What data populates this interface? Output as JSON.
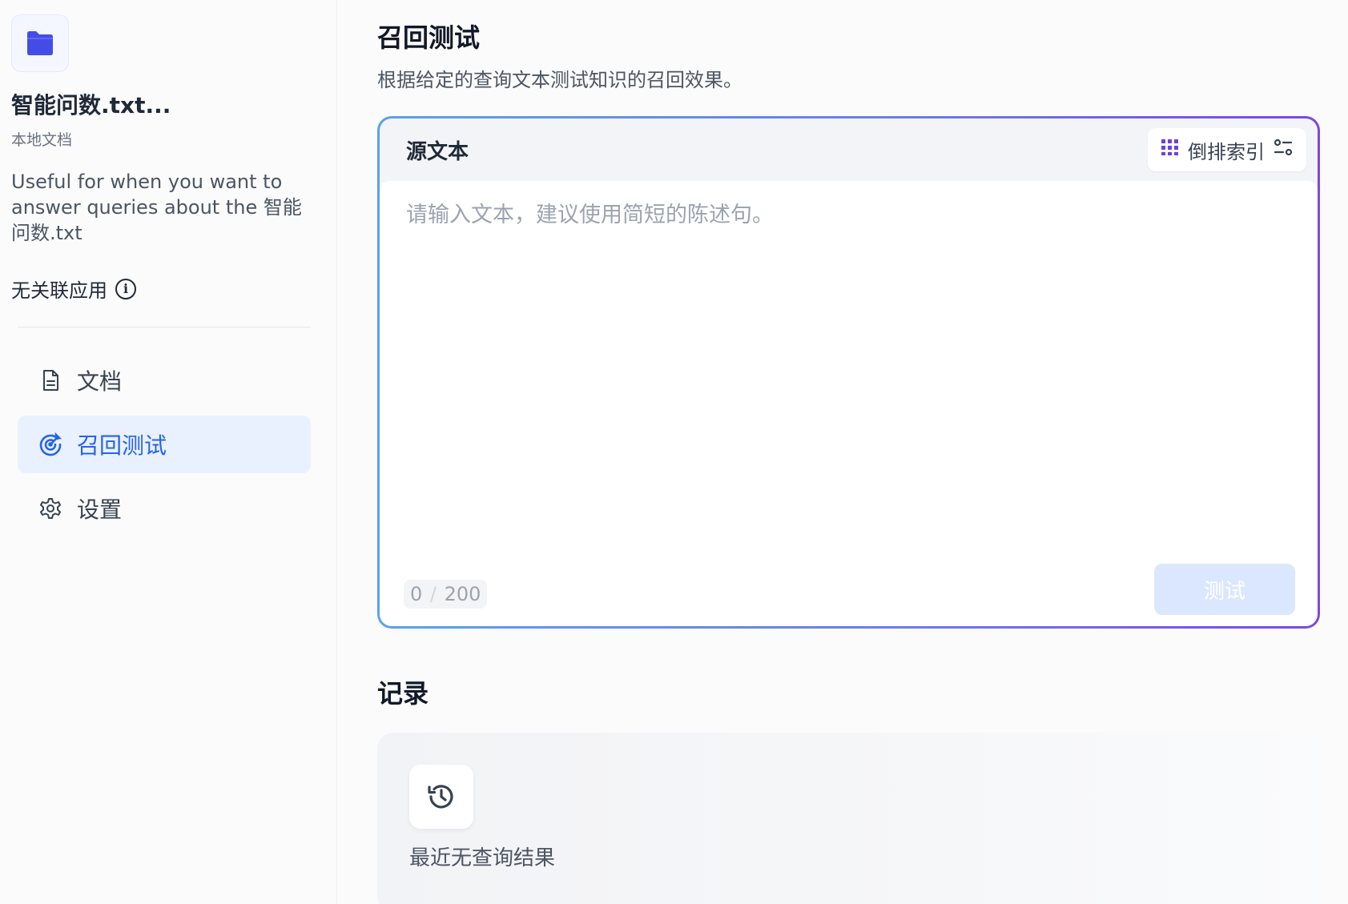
{
  "sidebar": {
    "kb_icon": "folder-icon",
    "kb_title": "智能问数.txt...",
    "kb_type": "本地文档",
    "kb_description": "Useful for when you want to answer queries about the 智能问数.txt",
    "linked_apps": "无关联应用",
    "nav": [
      {
        "label": "文档",
        "icon": "document-icon",
        "active": false
      },
      {
        "label": "召回测试",
        "icon": "target-icon",
        "active": true
      },
      {
        "label": "设置",
        "icon": "gear-icon",
        "active": false
      }
    ]
  },
  "main": {
    "title": "召回测试",
    "subtitle": "根据给定的查询文本测试知识的召回效果。",
    "source": {
      "label": "源文本",
      "index_mode": "倒排索引",
      "placeholder": "请输入文本，建议使用简短的陈述句。",
      "value": "",
      "count": "0",
      "max": "200",
      "test_button": "测试"
    },
    "records": {
      "title": "记录",
      "empty_text": "最近无查询结果"
    }
  },
  "colors": {
    "accent": "#2563eb",
    "active_bg": "#eaf1fe",
    "kb_icon": "#444ce7",
    "gradient_start": "#5aa2ea",
    "gradient_end": "#7b48e0",
    "button_disabled": "#dbe7fe"
  }
}
